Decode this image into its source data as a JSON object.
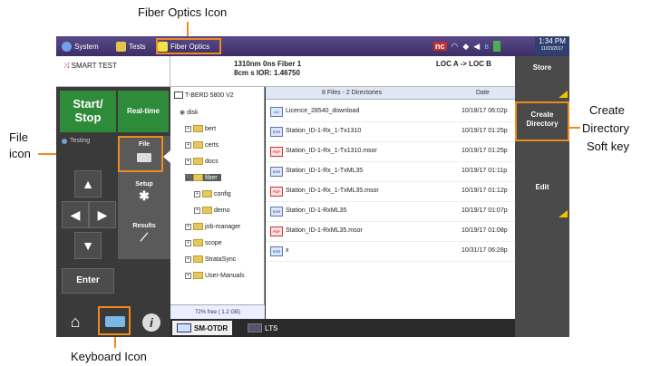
{
  "callouts": {
    "fiber_optics_icon": "Fiber Optics Icon",
    "file_icon_line1": "File",
    "file_icon_line2": "icon",
    "create_dir_line1": "Create",
    "create_dir_line2": "Directory",
    "create_dir_line3": "Soft key",
    "keyboard_icon": "Keyboard Icon"
  },
  "topbar": {
    "tabs": [
      {
        "label": "System",
        "icon": "gear-icon"
      },
      {
        "label": "Tests",
        "icon": "tests-icon"
      },
      {
        "label": "Fiber Optics",
        "icon": "fiber-optics-icon"
      }
    ],
    "nc_label": "nc",
    "time": "1:34 PM",
    "date": "11/03/2017"
  },
  "info": {
    "smart_test": "SMART TEST",
    "line1": "1310nm  0ns  Fiber 1",
    "line2": "8cm  s  IOR: 1.46750",
    "loc": "LOC A -> LOC B"
  },
  "left": {
    "start_stop_line1": "Start/",
    "start_stop_line2": "Stop",
    "realtime": "Real-time",
    "testing": "Testing",
    "file_tab": "File",
    "setup_tab": "Setup",
    "results_tab": "Results",
    "enter": "Enter"
  },
  "tree": {
    "items": [
      {
        "label": "T-BERD 5800 V2",
        "indent": 0
      },
      {
        "label": "disk",
        "indent": 1
      },
      {
        "label": "bert",
        "indent": 2
      },
      {
        "label": "certs",
        "indent": 2
      },
      {
        "label": "docs",
        "indent": 2
      },
      {
        "label": "fiber",
        "indent": 2
      },
      {
        "label": "config",
        "indent": 3
      },
      {
        "label": "demo",
        "indent": 3
      },
      {
        "label": "job-manager",
        "indent": 2
      },
      {
        "label": "scope",
        "indent": 2
      },
      {
        "label": "StrataSync",
        "indent": 2
      },
      {
        "label": "User-Manuals",
        "indent": 2
      }
    ],
    "footer": "72% free ( 1.2 GB)"
  },
  "filelist": {
    "header_name": "8 Files - 2 Directories",
    "header_date": "Date",
    "rows": [
      {
        "name": "Licence_28540_download",
        "date": "10/18/17 06:02p",
        "type": "LIC"
      },
      {
        "name": "Station_ID-1-Rx_1-Tx1310",
        "date": "10/19/17 01:25p",
        "type": "SOR"
      },
      {
        "name": "Station_ID-1-Rx_1-Tx1310.msor",
        "date": "10/19/17 01:25p",
        "type": "PDF"
      },
      {
        "name": "Station_ID-1-Rx_1-TxML35",
        "date": "10/19/17 01:11p",
        "type": "SOR"
      },
      {
        "name": "Station_ID-1-Rx_1-TxML35.msor",
        "date": "10/19/17 01:12p",
        "type": "PDF"
      },
      {
        "name": "Station_ID-1-RxML35",
        "date": "10/19/17 01:07p",
        "type": "SOR"
      },
      {
        "name": "Station_ID-1-RxML35.msor",
        "date": "10/19/17 01:08p",
        "type": "PDF"
      },
      {
        "name": "x",
        "date": "10/31/17 06:28p",
        "type": "SOR"
      }
    ]
  },
  "softkeys": {
    "store": "Store",
    "create_line1": "Create",
    "create_line2": "Directory",
    "edit": "Edit"
  },
  "bottom_tabs": {
    "sm_otdr": "SM-OTDR",
    "lts": "LTS"
  },
  "colors": {
    "callout_orange": "#f08a1c",
    "start_green": "#2e8b3a",
    "topbar_purple": "#4a3b78"
  }
}
